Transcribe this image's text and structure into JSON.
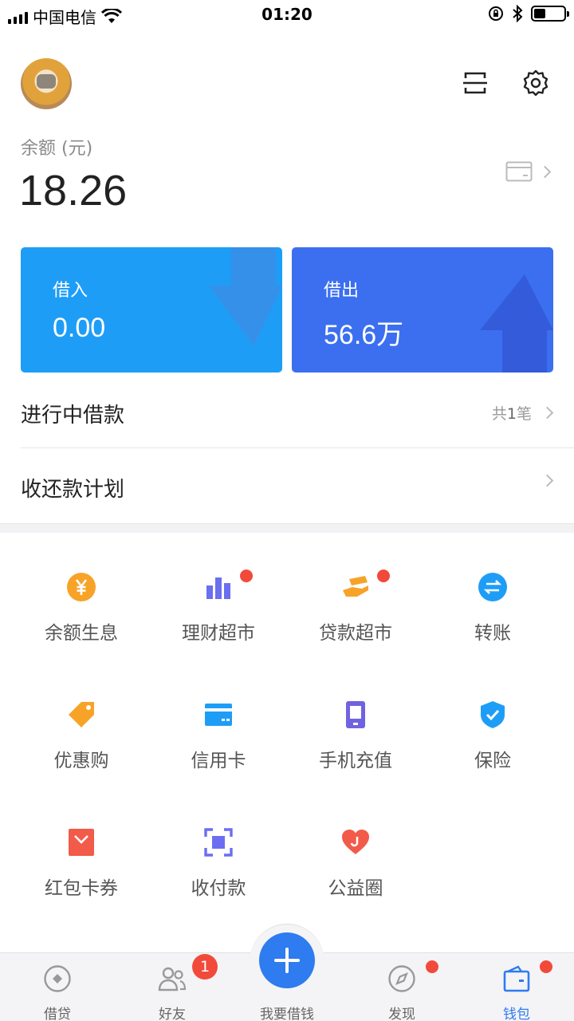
{
  "status_bar": {
    "carrier": "中国电信",
    "time": "01:20"
  },
  "header": {
    "scan_icon": "scan-icon",
    "settings_icon": "gear-icon"
  },
  "balance": {
    "label": "余额 (元)",
    "value": "18.26"
  },
  "cards": {
    "borrow_in": {
      "title": "借入",
      "value": "0.00"
    },
    "lend_out": {
      "title": "借出",
      "value": "56.6万"
    }
  },
  "rows": {
    "ongoing": {
      "label": "进行中借款",
      "prefix": "共",
      "count": "1",
      "suffix": "笔"
    },
    "plan": {
      "label": "收还款计划"
    }
  },
  "grid": [
    {
      "label": "余额生息",
      "icon": "yuan-coin-icon",
      "color": "#f7a328"
    },
    {
      "label": "理财超市",
      "icon": "bar-chart-icon",
      "color": "#6b6ef0",
      "dot": true
    },
    {
      "label": "贷款超市",
      "icon": "loan-hand-icon",
      "color": "#f7a328",
      "dot": true
    },
    {
      "label": "转账",
      "icon": "transfer-icon",
      "color": "#1e9df7"
    },
    {
      "label": "优惠购",
      "icon": "price-tag-icon",
      "color": "#f7a328"
    },
    {
      "label": "信用卡",
      "icon": "credit-card-icon",
      "color": "#1e9df7"
    },
    {
      "label": "手机充值",
      "icon": "phone-icon",
      "color": "#7063e0"
    },
    {
      "label": "保险",
      "icon": "shield-icon",
      "color": "#1e9df7"
    },
    {
      "label": "红包卡券",
      "icon": "red-envelope-icon",
      "color": "#f25a4a"
    },
    {
      "label": "收付款",
      "icon": "scan-frame-icon",
      "color": "#6b6ef0"
    },
    {
      "label": "公益圈",
      "icon": "heart-icon",
      "color": "#f25a4a"
    }
  ],
  "tabbar": {
    "loan": "借贷",
    "friends": "好友",
    "friends_badge": "1",
    "borrow": "我要借钱",
    "discover": "发现",
    "wallet": "钱包",
    "active_color": "#2f7bf0"
  }
}
